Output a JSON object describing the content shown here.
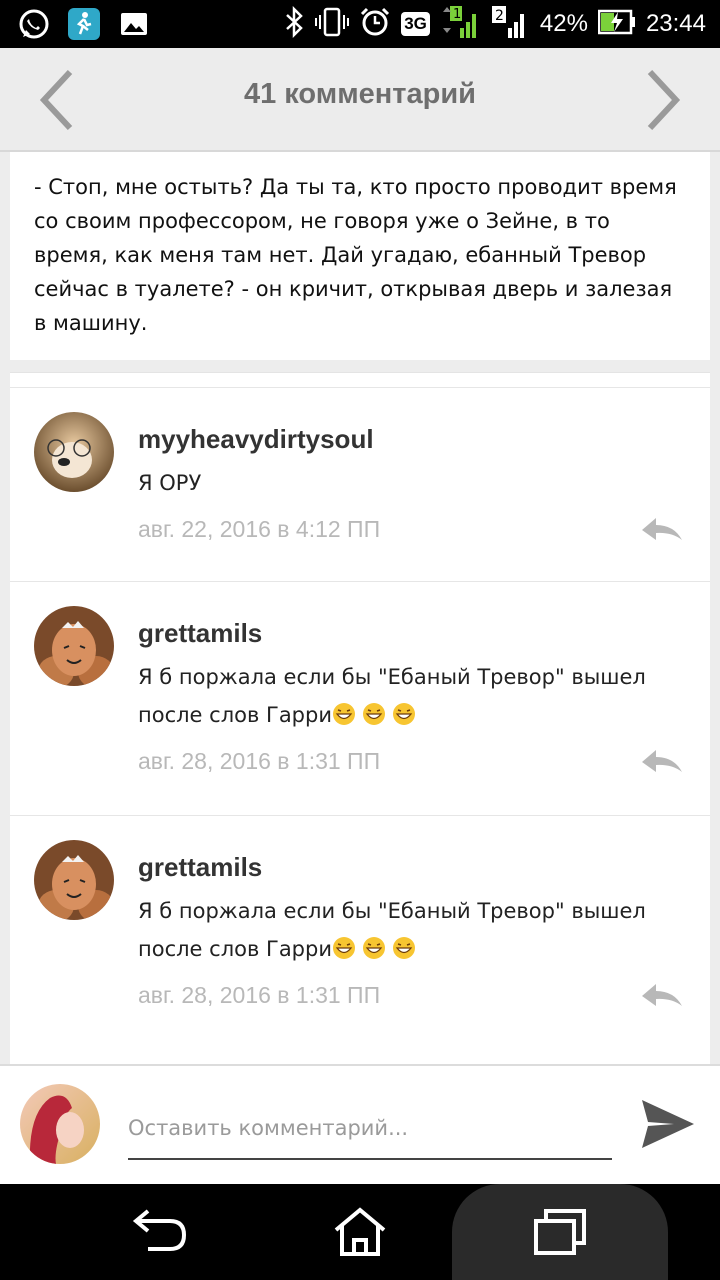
{
  "status_bar": {
    "battery": "42%",
    "time": "23:44",
    "network": "3G",
    "sim1": "1",
    "sim2": "2",
    "icons": [
      "whatsapp-icon",
      "fitness-app-icon",
      "gallery-icon",
      "bluetooth-icon",
      "vibrate-icon",
      "alarm-icon",
      "battery-charging-icon"
    ]
  },
  "header": {
    "title": "41 комментарий",
    "prev_icon": "chevron-left-icon",
    "next_icon": "chevron-right-icon"
  },
  "story": {
    "text": "- Стоп, мне остыть? Да ты та, кто просто проводит время со своим профессором, не говоря уже о Зейне, в то время, как меня там нет. Дай угадаю, ебанный Тревор сейчас в туалете? - он кричит, открывая дверь и залезая в машину."
  },
  "comments": [
    {
      "user": "myyheavydirtysoul",
      "text": "Я ОРУ",
      "date": "авг. 22, 2016 в 4:12 ПП",
      "emoji_count": 0
    },
    {
      "user": "grettamils",
      "text": "Я б поржала если бы \"Ебаный Тревор\" вышел после слов Гарри",
      "date": "авг. 28, 2016 в 1:31 ПП",
      "emoji_count": 3
    },
    {
      "user": "grettamils",
      "text": "Я б поржала если бы \"Ебаный Тревор\" вышел после слов Гарри",
      "date": "авг. 28, 2016 в 1:31 ПП",
      "emoji_count": 3
    }
  ],
  "compose": {
    "placeholder": "Оставить комментарий..."
  },
  "colors": {
    "accent_battery": "#7bd13a",
    "signal_green": "#7bd13a",
    "date_gray": "#b8b8b8"
  }
}
